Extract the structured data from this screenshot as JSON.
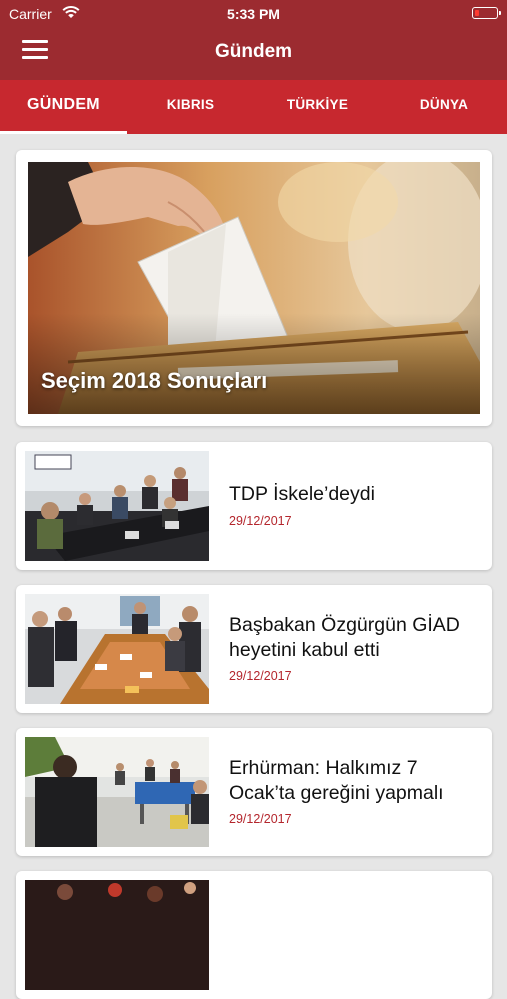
{
  "status_bar": {
    "carrier": "Carrier",
    "time": "5:33 PM"
  },
  "nav": {
    "title": "Gündem"
  },
  "tabs": [
    {
      "label": "GÜNDEM",
      "active": true
    },
    {
      "label": "KIBRIS",
      "active": false
    },
    {
      "label": "TÜRKİYE",
      "active": false
    },
    {
      "label": "DÜNYA",
      "active": false
    }
  ],
  "featured": {
    "title": "Seçim 2018 Sonuçları"
  },
  "articles": [
    {
      "title": "TDP İskele’deydi",
      "date": "29/12/2017"
    },
    {
      "title": "Başbakan Özgürgün GİAD heyetini kabul etti",
      "date": "29/12/2017"
    },
    {
      "title": "Erhürman: Halkımız 7 Ocak’ta gereğini yapmalı",
      "date": "29/12/2017"
    }
  ],
  "colors": {
    "nav_bg": "#9c2b30",
    "tab_bg": "#c7282f",
    "date": "#b4262d"
  }
}
